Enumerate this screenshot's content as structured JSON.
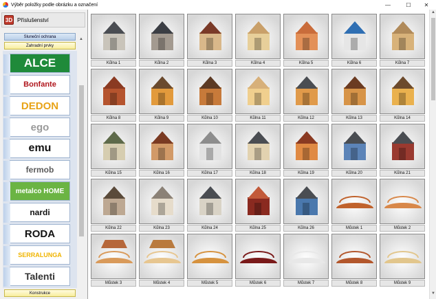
{
  "window": {
    "title": "Výběr položky podle obrázku a označení",
    "controls": {
      "minimize": "—",
      "maximize": "☐",
      "close": "✕"
    }
  },
  "sidebar": {
    "badge": "3D",
    "title": "Příslušenství",
    "categories": [
      {
        "label": "Sluneční ochrana",
        "style": "blue"
      },
      {
        "label": "Zahradní prvky",
        "style": "yellow"
      }
    ],
    "brands": [
      {
        "label": "ALCE",
        "color": "#1a1a1a",
        "bg": "#1f8a3a",
        "fg": "#ffffff",
        "size": 17
      },
      {
        "label": "Bonfante",
        "color": "#b0161d",
        "bg": "#ffffff",
        "fg": "#b0161d",
        "size": 11
      },
      {
        "label": "DEDON",
        "color": "#e8a317",
        "bg": "#ffffff",
        "fg": "#e8a317",
        "size": 15
      },
      {
        "label": "ego",
        "color": "#9a9a9a",
        "bg": "#ffffff",
        "fg": "#9a9a9a",
        "size": 15
      },
      {
        "label": "emu",
        "color": "#111111",
        "bg": "#ffffff",
        "fg": "#111111",
        "size": 16
      },
      {
        "label": "fermob",
        "color": "#5b5b5b",
        "bg": "#ffffff",
        "fg": "#5b5b5b",
        "size": 12
      },
      {
        "label": "metalco HOME",
        "color": "#5fa83b",
        "bg": "#6bb443",
        "fg": "#ffffff",
        "size": 10
      },
      {
        "label": "nardi",
        "color": "#111111",
        "bg": "#ffffff",
        "fg": "#111111",
        "size": 12
      },
      {
        "label": "RODA",
        "color": "#111111",
        "bg": "#ffffff",
        "fg": "#111111",
        "size": 15
      },
      {
        "label": "SERRALUNGA",
        "color": "#f0b400",
        "bg": "#ffffff",
        "fg": "#f0b400",
        "size": 9
      },
      {
        "label": "Talenti",
        "color": "#333333",
        "bg": "#ffffff",
        "fg": "#333333",
        "size": 14
      }
    ],
    "footer_category": {
      "label": "Konstrukce",
      "style": "yellow"
    }
  },
  "items": [
    {
      "label": "Kůlna 1",
      "kind": "shed",
      "roof": "#4a4d52",
      "body": "#c9c4ba"
    },
    {
      "label": "Kůlna 2",
      "kind": "shed",
      "roof": "#3b3e44",
      "body": "#a39a90"
    },
    {
      "label": "Kůlna 3",
      "kind": "shed",
      "roof": "#7a3a28",
      "body": "#d9b88a"
    },
    {
      "label": "Kůlna 4",
      "kind": "shed",
      "roof": "#c9a06a",
      "body": "#e7cf9a"
    },
    {
      "label": "Kůlna 5",
      "kind": "shed",
      "roof": "#c96c3b",
      "body": "#e39058"
    },
    {
      "label": "Kůlna 6",
      "kind": "shed",
      "roof": "#2f6fb3",
      "body": "#e6e6e6"
    },
    {
      "label": "Kůlna 7",
      "kind": "shed",
      "roof": "#b08a5a",
      "body": "#d8b27a"
    },
    {
      "label": "Kůlna 8",
      "kind": "shed",
      "roof": "#8a3a22",
      "body": "#b5542e"
    },
    {
      "label": "Kůlna 9",
      "kind": "shed",
      "roof": "#6a4a2e",
      "body": "#e29a3c"
    },
    {
      "label": "Kůlna 10",
      "kind": "shed",
      "roof": "#5c3a24",
      "body": "#c77a3a"
    },
    {
      "label": "Kůlna 11",
      "kind": "shed",
      "roof": "#d7b07a",
      "body": "#f0cf8e"
    },
    {
      "label": "Kůlna 12",
      "kind": "shed",
      "roof": "#4a4d52",
      "body": "#e09a4a"
    },
    {
      "label": "Kůlna 13",
      "kind": "shed",
      "roof": "#6b3b22",
      "body": "#d79448"
    },
    {
      "label": "Kůlna 14",
      "kind": "shed",
      "roof": "#6c4a2c",
      "body": "#eab14e"
    },
    {
      "label": "Kůlna 15",
      "kind": "shed",
      "roof": "#5e6a4a",
      "body": "#d6cdb0"
    },
    {
      "label": "Kůlna 16",
      "kind": "shed",
      "roof": "#7a3a22",
      "body": "#d29a68"
    },
    {
      "label": "Kůlna 17",
      "kind": "shed",
      "roof": "#8d8d8d",
      "body": "#e2e2e2"
    },
    {
      "label": "Kůlna 18",
      "kind": "shed",
      "roof": "#4a4d52",
      "body": "#e2d2b0"
    },
    {
      "label": "Kůlna 19",
      "kind": "shed",
      "roof": "#8a3a22",
      "body": "#e08a44"
    },
    {
      "label": "Kůlna 20",
      "kind": "shed",
      "roof": "#4a4d52",
      "body": "#5c84b8"
    },
    {
      "label": "Kůlna 21",
      "kind": "shed",
      "roof": "#4a4d52",
      "body": "#9a3a30"
    },
    {
      "label": "Kůlna 22",
      "kind": "shed",
      "roof": "#5a4a3a",
      "body": "#bda892"
    },
    {
      "label": "Kůlna 23",
      "kind": "shed",
      "roof": "#8b8176",
      "body": "#e6dccb"
    },
    {
      "label": "Kůlna 24",
      "kind": "shed",
      "roof": "#4a4d52",
      "body": "#d9d3c6"
    },
    {
      "label": "Kůlna 25",
      "kind": "shed",
      "roof": "#c25a3a",
      "body": "#8a2a20"
    },
    {
      "label": "Kůlna 26",
      "kind": "shed",
      "roof": "#4a4d52",
      "body": "#4a78ad"
    },
    {
      "label": "Můstek 1",
      "kind": "bridge",
      "roof": "",
      "body": "#c0622c"
    },
    {
      "label": "Můstek 2",
      "kind": "bridge",
      "roof": "",
      "body": "#d8884a"
    },
    {
      "label": "Můstek 3",
      "kind": "bridge",
      "roof": "#b6673a",
      "body": "#d99a5a"
    },
    {
      "label": "Můstek 4",
      "kind": "bridge",
      "roof": "#b97a3e",
      "body": "#e7c690"
    },
    {
      "label": "Můstek 5",
      "kind": "bridge",
      "roof": "",
      "body": "#d6923e"
    },
    {
      "label": "Můstek 6",
      "kind": "bridge",
      "roof": "",
      "body": "#7a1a1a"
    },
    {
      "label": "Můstek 7",
      "kind": "bridge",
      "roof": "",
      "body": "#e8e8e8"
    },
    {
      "label": "Můstek 8",
      "kind": "bridge",
      "roof": "",
      "body": "#b3572c"
    },
    {
      "label": "Můstek 9",
      "kind": "bridge",
      "roof": "",
      "body": "#e2c68c"
    }
  ]
}
